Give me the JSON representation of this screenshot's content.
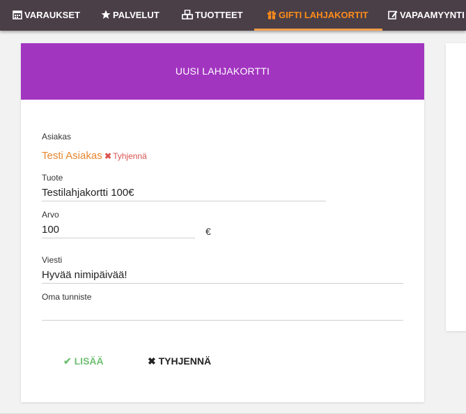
{
  "nav": {
    "items": [
      {
        "label": "VARAUKSET",
        "icon": "calendar-icon"
      },
      {
        "label": "PALVELUT",
        "icon": "star-icon"
      },
      {
        "label": "TUOTTEET",
        "icon": "cubes-icon"
      },
      {
        "label": "GIFTI LAHJAKORTIT",
        "icon": "gift-icon",
        "active": true
      },
      {
        "label": "VAPAAMYYNTI",
        "icon": "edit-icon"
      }
    ],
    "active_color": "#ff8c1a",
    "background": "#4a3f47"
  },
  "card": {
    "title": "UUSI LAHJAKORTTI",
    "header_color": "#a235c0"
  },
  "form": {
    "customer_label": "Asiakas",
    "customer_name": "Testi Asiakas",
    "customer_clear": "Tyhjennä",
    "product_label": "Tuote",
    "product_value": "Testilahjakortti 100€",
    "value_label": "Arvo",
    "value_value": "100",
    "currency": "€",
    "message_label": "Viesti",
    "message_value": "Hyvää nimipäivää!",
    "tag_label": "Oma tunniste",
    "tag_value": ""
  },
  "actions": {
    "add_label": "LISÄÄ",
    "clear_label": "TYHJENNÄ"
  }
}
